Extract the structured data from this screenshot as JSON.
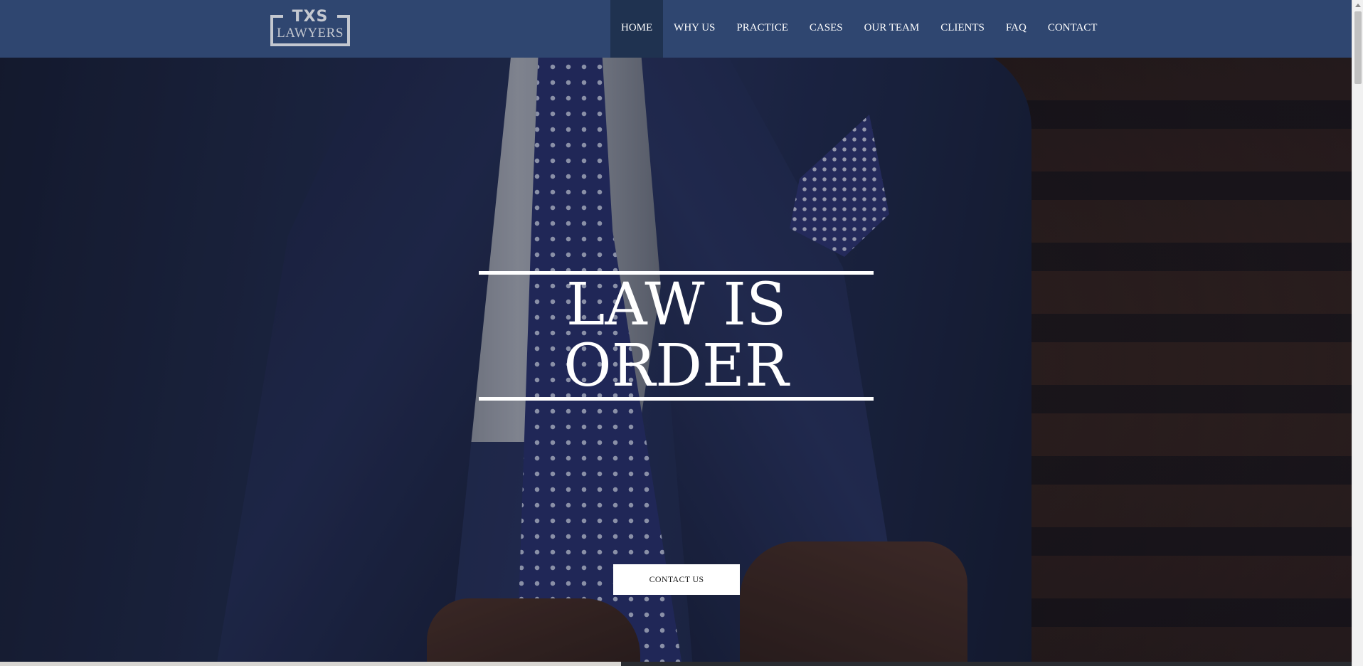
{
  "logo": {
    "line1": "TXS",
    "line2": "LAWYERS",
    "color": "#c4c8d0"
  },
  "nav": {
    "items": [
      {
        "label": "HOME",
        "active": true
      },
      {
        "label": "WHY US",
        "active": false
      },
      {
        "label": "PRACTICE",
        "active": false
      },
      {
        "label": "CASES",
        "active": false
      },
      {
        "label": "OUR TEAM",
        "active": false
      },
      {
        "label": "CLIENTS",
        "active": false
      },
      {
        "label": "FAQ",
        "active": false
      },
      {
        "label": "CONTACT",
        "active": false
      }
    ]
  },
  "hero": {
    "headline_line1": "LAW IS",
    "headline_line2": "ORDER",
    "cta_label": "CONTACT US"
  },
  "colors": {
    "header_bg": "#2f4670",
    "nav_active_bg": "#1f3250",
    "text_light": "#ffffff",
    "cta_bg": "#ffffff"
  }
}
